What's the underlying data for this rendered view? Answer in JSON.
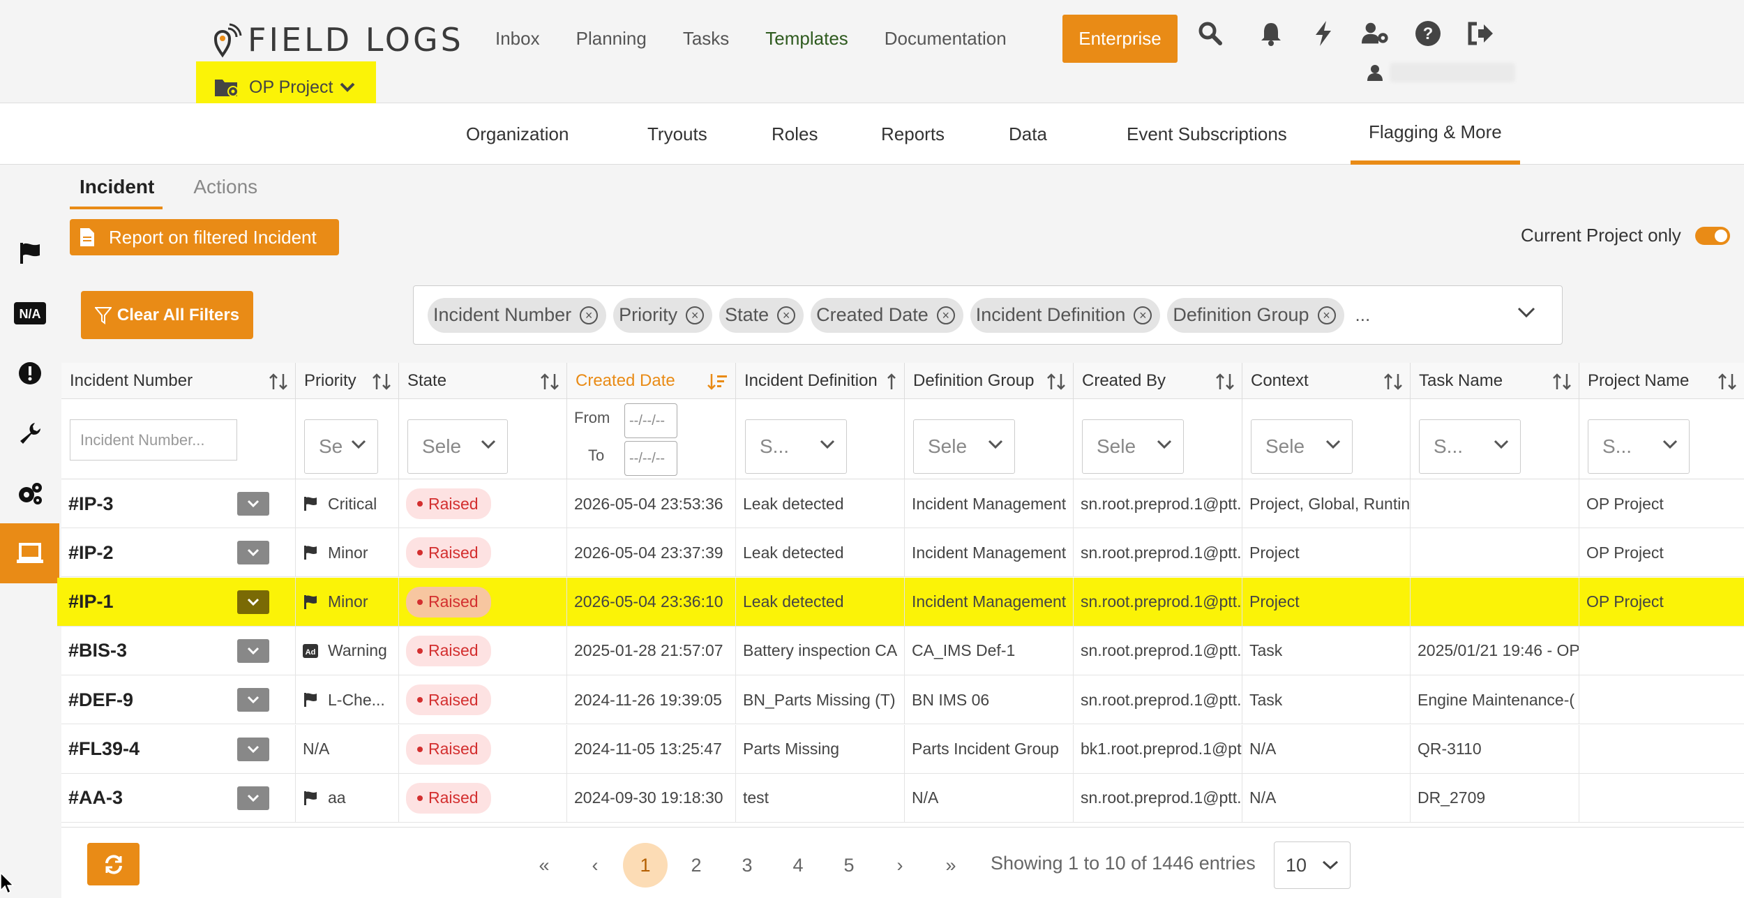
{
  "app": {
    "logo_text": "FIELD LOGS",
    "nav": [
      "Inbox",
      "Planning",
      "Tasks",
      "Templates",
      "Documentation"
    ],
    "enterprise_label": "Enterprise",
    "project_label": "OP Project",
    "icons": [
      "search-icon",
      "bell-icon",
      "bolt-icon",
      "user-gear-icon",
      "help-icon",
      "logout-icon"
    ]
  },
  "subnav": [
    "Organization",
    "Tryouts",
    "Roles",
    "Reports",
    "Data",
    "Event Subscriptions",
    "Flagging & More"
  ],
  "tabs": [
    "Incident",
    "Actions"
  ],
  "report_button": "Report on filtered Incident",
  "current_project_label": "Current Project only",
  "clear_filters_label": "Clear All Filters",
  "filter_chips": [
    "Incident Number",
    "Priority",
    "State",
    "Created Date",
    "Incident Definition",
    "Definition Group"
  ],
  "filter_more": "...",
  "columns": [
    "Incident Number",
    "Priority",
    "State",
    "Created Date",
    "Incident Definition",
    "Definition Group",
    "Created By",
    "Context",
    "Task Name",
    "Project Name"
  ],
  "filters": {
    "incident_placeholder": "Incident Number...",
    "priority": "Sele",
    "state": "Sele",
    "date_from_label": "From",
    "date_to_label": "To",
    "date_placeholder": "--/--/--",
    "definition": "S...",
    "group": "Sele",
    "created_by": "Sele",
    "context": "Sele",
    "task": "S...",
    "project": "S..."
  },
  "rows": [
    {
      "id": "#IP-3",
      "priority": "Critical",
      "pri_icon": "flag-icon",
      "state": "Raised",
      "created": "2026-05-04 23:53:36",
      "definition": "Leak detected",
      "group": "Incident Management",
      "by": "sn.root.preprod.1@ptt.",
      "context": "Project, Global, Runtin",
      "task": "",
      "project": "OP Project"
    },
    {
      "id": "#IP-2",
      "priority": "Minor",
      "pri_icon": "flag-icon",
      "state": "Raised",
      "created": "2026-05-04 23:37:39",
      "definition": "Leak detected",
      "group": "Incident Management",
      "by": "sn.root.preprod.1@ptt.",
      "context": "Project",
      "task": "",
      "project": "OP Project"
    },
    {
      "id": "#IP-1",
      "priority": "Minor",
      "pri_icon": "flag-icon",
      "state": "Raised",
      "created": "2026-05-04 23:36:10",
      "definition": "Leak detected",
      "group": "Incident Management",
      "by": "sn.root.preprod.1@ptt.",
      "context": "Project",
      "task": "",
      "project": "OP Project"
    },
    {
      "id": "#BIS-3",
      "priority": "Warning",
      "pri_icon": "ad-icon",
      "state": "Raised",
      "created": "2025-01-28 21:57:07",
      "definition": "Battery inspection CA",
      "group": "CA_IMS Def-1",
      "by": "sn.root.preprod.1@ptt.",
      "context": "Task",
      "task": "2025/01/21 19:46 - OP",
      "project": ""
    },
    {
      "id": "#DEF-9",
      "priority": "L-Che...",
      "pri_icon": "flag-icon",
      "state": "Raised",
      "created": "2024-11-26 19:39:05",
      "definition": "BN_Parts Missing (T)",
      "group": "BN IMS 06",
      "by": "sn.root.preprod.1@ptt.",
      "context": "Task",
      "task": "Engine Maintenance-(",
      "project": ""
    },
    {
      "id": "#FL39-4",
      "priority": "N/A",
      "pri_icon": "",
      "state": "Raised",
      "created": "2024-11-05 13:25:47",
      "definition": "Parts Missing",
      "group": "Parts Incident Group",
      "by": "bk1.root.preprod.1@ptt",
      "context": "N/A",
      "task": "QR-3110",
      "project": ""
    },
    {
      "id": "#AA-3",
      "priority": "aa",
      "pri_icon": "flag-icon",
      "state": "Raised",
      "created": "2024-09-30 19:18:30",
      "definition": "test",
      "group": "N/A",
      "by": "sn.root.preprod.1@ptt.",
      "context": "N/A",
      "task": "DR_2709",
      "project": ""
    }
  ],
  "pagination": {
    "first": "«",
    "prev": "‹",
    "pages": [
      "1",
      "2",
      "3",
      "4",
      "5"
    ],
    "next": "›",
    "last": "»",
    "showing": "Showing 1 to 10 of 1446 entries",
    "page_size": "10"
  },
  "colors": {
    "accent": "#e98b16",
    "highlight": "#fbf307",
    "raised": "#d32f2f"
  }
}
